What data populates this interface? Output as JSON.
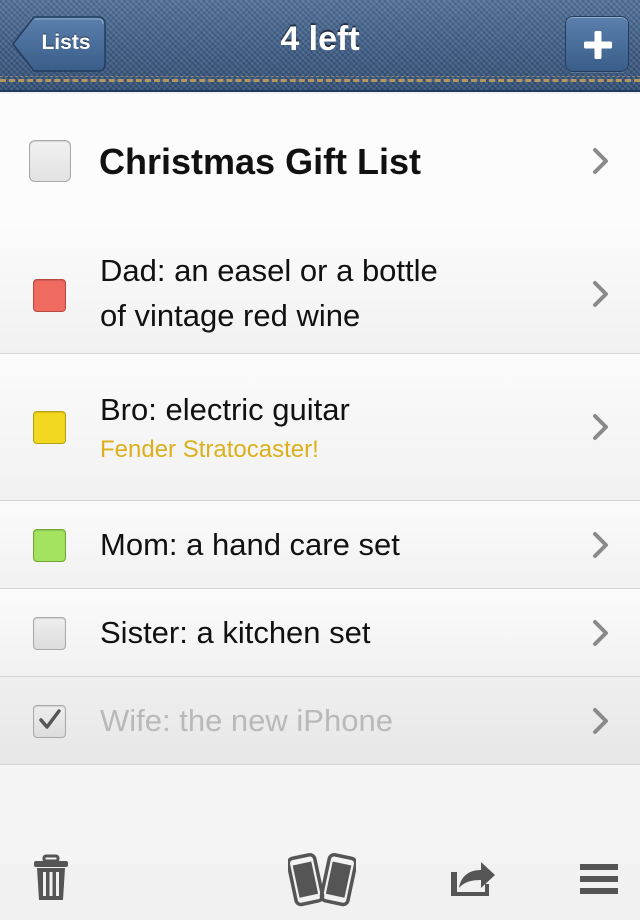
{
  "navbar": {
    "title": "4 left",
    "back_label": "Lists",
    "add_icon": "plus-icon"
  },
  "list": {
    "title": "Christmas Gift List",
    "items": [
      {
        "text": "Dad: an easel or a bottle of vintage red wine",
        "line1": "Dad: an easel or a bottle",
        "line2": "of vintage red wine",
        "note": "",
        "color": "#ef6b5f",
        "checked": false
      },
      {
        "text": "Bro: electric guitar",
        "note": "Fender Stratocaster!",
        "color": "#f2d81e",
        "checked": false
      },
      {
        "text": "Mom: a hand care set",
        "note": "",
        "color": "#a3e360",
        "checked": false
      },
      {
        "text": "Sister: a kitchen set",
        "note": "",
        "color": "#e6e6e6",
        "checked": false
      },
      {
        "text": "Wife: the new iPhone",
        "note": "",
        "color": "#e6e6e6",
        "checked": true
      }
    ]
  },
  "toolbar": {
    "icons": [
      "trash-icon",
      "sync-devices-icon",
      "share-icon",
      "menu-icon"
    ]
  },
  "colors": {
    "navbar": "#3f5f88",
    "note_text": "#dbb01c",
    "completed_text": "#b9b9b9"
  }
}
